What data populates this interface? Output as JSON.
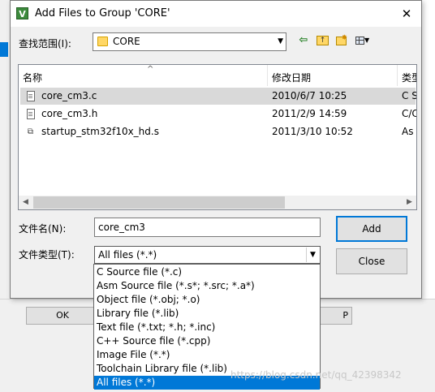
{
  "background_app": {
    "ok_label": "OK",
    "right_button_label": "P"
  },
  "dialog": {
    "title": "Add Files to Group 'CORE'",
    "app_icon_glyph": "V",
    "close_glyph": "✕"
  },
  "look_in": {
    "label": "查找范围(I):",
    "value": "CORE"
  },
  "file_list": {
    "columns": [
      "名称",
      "修改日期",
      "类型"
    ],
    "files": [
      {
        "name": "core_cm3.c",
        "date": "2010/6/7 10:25",
        "type": "C S",
        "icon": "c-file-icon"
      },
      {
        "name": "core_cm3.h",
        "date": "2011/2/9 14:59",
        "type": "C/C",
        "icon": "h-file-icon"
      },
      {
        "name": "startup_stm32f10x_hd.s",
        "date": "2011/3/10 10:52",
        "type": "As",
        "icon": "asm-file-icon"
      }
    ]
  },
  "file_name": {
    "label": "文件名(N):",
    "value": "core_cm3"
  },
  "file_type": {
    "label": "文件类型(T):",
    "value": "All files (*.*)",
    "options": [
      "C Source file (*.c)",
      "Asm Source file (*.s*; *.src; *.a*)",
      "Object file (*.obj; *.o)",
      "Library file (*.lib)",
      "Text file (*.txt; *.h; *.inc)",
      "C++ Source file (*.cpp)",
      "Image File (*.*)",
      "Toolchain Library file (*.lib)",
      "All files (*.*)"
    ]
  },
  "buttons": {
    "add": "Add",
    "close": "Close"
  },
  "watermark": "https://blog.csdn.net/qq_42398342"
}
